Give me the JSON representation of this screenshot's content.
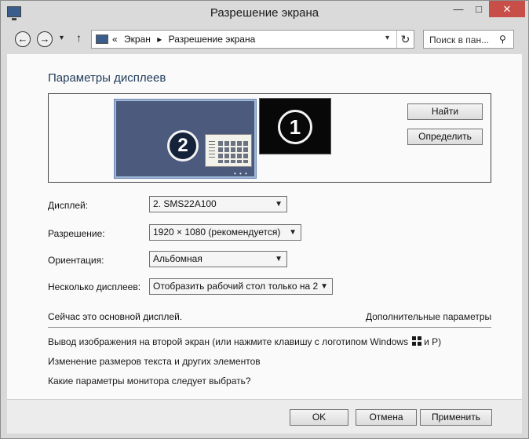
{
  "window": {
    "title": "Разрешение экрана",
    "controls": {
      "minimize": "—",
      "maximize": "□",
      "close": "✕"
    }
  },
  "nav": {
    "back_icon": "←",
    "forward_icon": "→",
    "history_icon": "▾",
    "up_icon": "↑",
    "address": {
      "prefix": "«",
      "crumbs": [
        "Экран",
        "Разрешение экрана"
      ],
      "separator": "▸",
      "dropdown_icon": "▾",
      "refresh_icon": "↻"
    },
    "search": {
      "placeholder": "Поиск в пан...",
      "icon": "⚲"
    }
  },
  "main": {
    "heading": "Параметры дисплеев",
    "preview": {
      "display2_number": "2",
      "display1_number": "1",
      "dots": "• • •",
      "find_button": "Найти",
      "detect_button": "Определить"
    },
    "fields": {
      "display": {
        "label": "Дисплей:",
        "value": "2. SMS22A100"
      },
      "resolution": {
        "label": "Разрешение:",
        "value": "1920 × 1080 (рекомендуется)"
      },
      "orientation": {
        "label": "Ориентация:",
        "value": "Альбомная"
      },
      "multiple": {
        "label": "Несколько дисплеев:",
        "value": "Отобразить рабочий стол только на 2"
      }
    },
    "primary_note": "Сейчас это основной дисплей.",
    "advanced_link": "Дополнительные параметры",
    "links": {
      "project": {
        "before": "Вывод изображения на второй экран (или нажмите клавишу с логотипом Windows",
        "after": "и P)"
      },
      "text_size": "Изменение размеров текста и других элементов",
      "which_settings": "Какие параметры монитора следует выбрать?"
    }
  },
  "footer": {
    "ok": "OK",
    "cancel": "Отмена",
    "apply": "Применить"
  },
  "colors": {
    "display2_fill": "#4c5a7e",
    "display1_fill": "#080808",
    "close_button": "#c74f48"
  }
}
